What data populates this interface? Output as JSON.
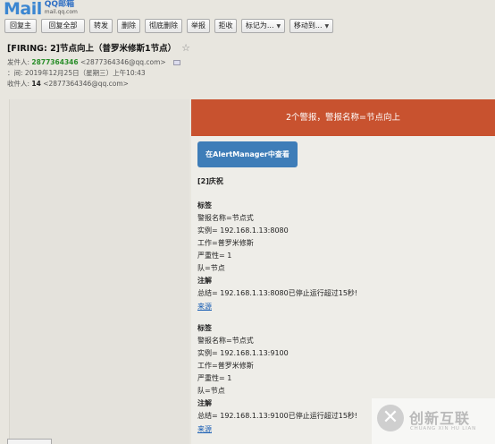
{
  "logo": {
    "mail": "Mail",
    "cn": "QQ邮箱",
    "url": "mail.qq.com"
  },
  "toolbar": {
    "reply": "回复主",
    "reply_all": "回复全部",
    "forward": "转发",
    "delete": "删除",
    "delete_permanent": "彻底删除",
    "report": "举报",
    "reject": "拒收",
    "mark_as": "标记为...",
    "move_to": "移动到..."
  },
  "header": {
    "subject": "[FIRING: 2]节点向上（普罗米修斯1节点）",
    "sender_label": "发件人:",
    "sender_name": "2877364346",
    "sender_addr": "<2877364346@qq.com>",
    "time_label": "：间:",
    "time_value": "2019年12月25日（星期三）上午10:43",
    "recipient_label": "收件人:",
    "recipient_name": "14",
    "recipient_addr": "<2877364346@qq.com>"
  },
  "body": {
    "banner": "2个警报，警报名称=节点向上",
    "view_button": "在AlertManager中查看",
    "section_title": "[2]庆祝",
    "labels_title": "标签",
    "notes_title": "注解",
    "source_link": "来源",
    "alerts": [
      {
        "alertname": "警报名称=节点式",
        "instance": "实例= 192.168.1.13:8080",
        "job": "工作=普罗米修斯",
        "severity": "严重性= 1",
        "team": "队=节点",
        "summary": "总结= 192.168.1.13:8080已停止运行超过15秒!"
      },
      {
        "alertname": "警报名称=节点式",
        "instance": "实例= 192.168.1.13:9100",
        "job": "工作=普罗米修斯",
        "severity": "严重性= 1",
        "team": "队=节点",
        "summary": "总结= 192.168.1.13:9100已停止运行超过15秒!"
      }
    ]
  },
  "watermark": {
    "icon": "brand-x-icon",
    "cn": "创新互联",
    "en": "CHUANG XIN HU LIAN"
  },
  "colors": {
    "banner": "#c8522f",
    "button": "#3e7db8",
    "sender": "#2a8e2a",
    "link": "#1a5fb4",
    "background": "#e8e6df"
  }
}
